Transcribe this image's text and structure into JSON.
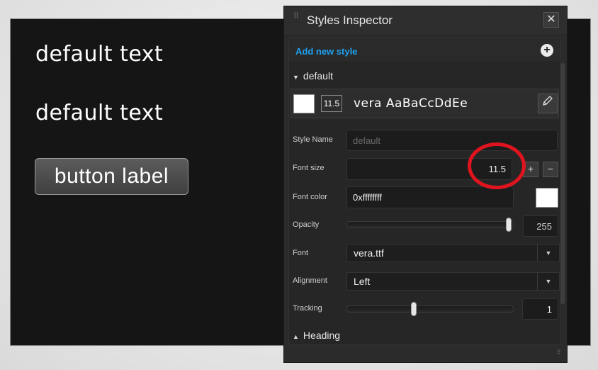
{
  "canvas": {
    "text1": "default text",
    "text2": "default text",
    "button_label": "button label"
  },
  "panel": {
    "title": "Styles Inspector",
    "close_glyph": "✕",
    "add_new_style": "Add new style",
    "add_icon": "+",
    "section_default": "default",
    "section_heading": "Heading",
    "style_card": {
      "size_badge": "11.5",
      "preview": "vera AaBaCcDdEe",
      "edit_icon": "pencil-icon"
    },
    "fields": {
      "style_name_label": "Style Name",
      "style_name_placeholder": "default",
      "font_size_label": "Font size",
      "font_size_value": "11.5",
      "font_color_label": "Font color",
      "font_color_value": "0xffffffff",
      "font_color_swatch": "#ffffff",
      "opacity_label": "Opacity",
      "opacity_value": "255",
      "opacity_level": 1.0,
      "font_label": "Font",
      "font_value": "vera.ttf",
      "alignment_label": "Alignment",
      "alignment_value": "Left",
      "tracking_label": "Tracking",
      "tracking_value": "1"
    }
  },
  "colors": {
    "accent": "#1ea1ef",
    "highlight_ring": "#e0141e"
  }
}
